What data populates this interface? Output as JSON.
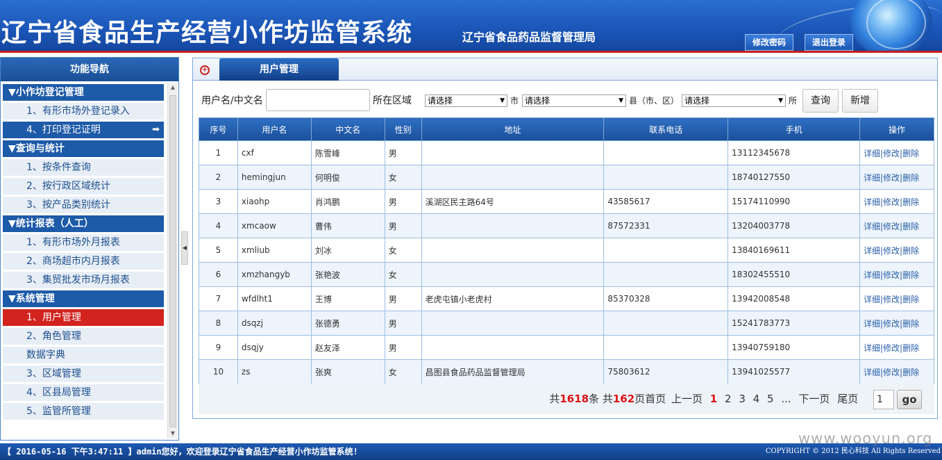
{
  "header": {
    "title": "辽宁省食品生产经营小作坊监管系统",
    "subtitle": "辽宁省食品药品监督管理局",
    "change_password": "修改密码",
    "logout": "退出登录"
  },
  "sidebar": {
    "title": "功能导航",
    "groups": [
      {
        "label": "▼小作坊登记管理",
        "items": [
          "1、有形市场外登记录入",
          "4、打印登记证明"
        ]
      },
      {
        "label": "▼查询与统计",
        "items": [
          "1、按条件查询",
          "2、按行政区域统计",
          "3、按产品类别统计"
        ]
      },
      {
        "label": "▼统计报表（人工）",
        "items": [
          "1、有形市场外月报表",
          "2、商场超市内月报表",
          "3、集贸批发市场月报表"
        ]
      },
      {
        "label": "▼系统管理",
        "items": [
          "1、用户管理",
          "2、角色管理",
          "数据字典",
          "3、区域管理",
          "4、区县局管理",
          "5、监管所管理"
        ]
      }
    ]
  },
  "panel": {
    "tab": "用户管理",
    "search": {
      "username_label": "用户名/中文名",
      "username_value": "",
      "area_label": "所在区域",
      "city_select": "请选择",
      "city_suffix": "市",
      "county_select": "请选择",
      "county_suffix": "县（市、区）",
      "office_select": "请选择",
      "office_suffix": "所",
      "query_button": "查询",
      "add_button": "新增"
    },
    "table": {
      "headers": [
        "序号",
        "用户名",
        "中文名",
        "性别",
        "地址",
        "联系电话",
        "手机",
        "操作"
      ],
      "rows": [
        [
          "1",
          "cxf",
          "陈雪峰",
          "男",
          "",
          "",
          "13112345678"
        ],
        [
          "2",
          "hemingjun",
          "何明俊",
          "女",
          "",
          "",
          "18740127550"
        ],
        [
          "3",
          "xiaohp",
          "肖鸿鹏",
          "男",
          "溪湖区民主路64号",
          "43585617",
          "15174110990"
        ],
        [
          "4",
          "xmcaow",
          "曹伟",
          "男",
          "",
          "87572331",
          "13204003778"
        ],
        [
          "5",
          "xmliub",
          "刘冰",
          "女",
          "",
          "",
          "13840169611"
        ],
        [
          "6",
          "xmzhangyb",
          "张艳波",
          "女",
          "",
          "",
          "18302455510"
        ],
        [
          "7",
          "wfdlht1",
          "王博",
          "男",
          "老虎屯镇小老虎村",
          "85370328",
          "13942008548"
        ],
        [
          "8",
          "dsqzj",
          "张德勇",
          "男",
          "",
          "",
          "15241783773"
        ],
        [
          "9",
          "dsqjy",
          "赵友泽",
          "男",
          "",
          "",
          "13940759180"
        ],
        [
          "10",
          "zs",
          "张爽",
          "女",
          "昌图县食品药品监督管理局",
          "75803612",
          "13941025577"
        ]
      ],
      "ops": [
        "详细",
        "修改",
        "删除"
      ]
    },
    "pager": {
      "prefix": "共",
      "total": "1618",
      "mid": "条 共",
      "pages": "162",
      "suffix": "页",
      "first": "首页",
      "prev": "上一页",
      "page_numbers": [
        "1",
        "2",
        "3",
        "4",
        "5"
      ],
      "current_page": "1",
      "ellipsis": "...",
      "next": "下一页",
      "last": "尾页",
      "page_input": "1",
      "go": "go"
    }
  },
  "footer": {
    "status": "【 2016-05-16 下午3:47:11 】admin您好，欢迎登录辽宁省食品生产经营小作坊监管系统!",
    "copyright": "COPYRIGHT © 2012 民心科技 All Rights Reserved",
    "watermark": "www.wooyun.org"
  }
}
